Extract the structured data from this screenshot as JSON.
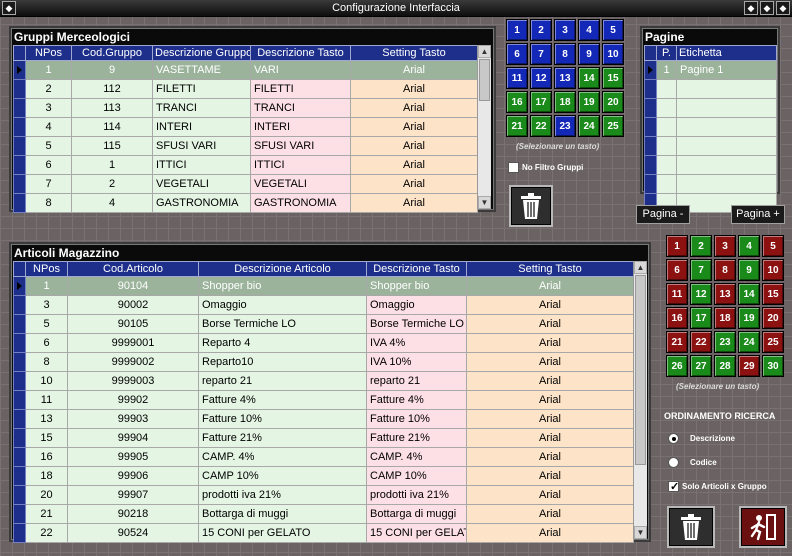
{
  "window": {
    "title": "Configurazione Interfaccia"
  },
  "gruppi": {
    "title": "Gruppi Merceologici",
    "columns": [
      "NPos",
      "Cod.Gruppo",
      "Descrizione Gruppo",
      "Descrizione Tasto",
      "Setting Tasto"
    ],
    "rows": [
      {
        "npos": "1",
        "cod": "9",
        "desc": "VASETTAME",
        "tasto": "VARI",
        "setting": "Arial"
      },
      {
        "npos": "2",
        "cod": "112",
        "desc": "FILETTI",
        "tasto": "FILETTI",
        "setting": "Arial"
      },
      {
        "npos": "3",
        "cod": "113",
        "desc": "TRANCI",
        "tasto": "TRANCI",
        "setting": "Arial"
      },
      {
        "npos": "4",
        "cod": "114",
        "desc": "INTERI",
        "tasto": "INTERI",
        "setting": "Arial"
      },
      {
        "npos": "5",
        "cod": "115",
        "desc": "SFUSI VARI",
        "tasto": "SFUSI VARI",
        "setting": "Arial"
      },
      {
        "npos": "6",
        "cod": "1",
        "desc": "ITTICI",
        "tasto": "ITTICI",
        "setting": "Arial"
      },
      {
        "npos": "7",
        "cod": "2",
        "desc": "VEGETALI",
        "tasto": "VEGETALI",
        "setting": "Arial"
      },
      {
        "npos": "8",
        "cod": "4",
        "desc": "GASTRONOMIA",
        "tasto": "GASTRONOMIA",
        "setting": "Arial"
      }
    ]
  },
  "keypad_top": {
    "keys": [
      {
        "n": "1",
        "c": "blue"
      },
      {
        "n": "2",
        "c": "blue"
      },
      {
        "n": "3",
        "c": "blue"
      },
      {
        "n": "4",
        "c": "blue"
      },
      {
        "n": "5",
        "c": "blue"
      },
      {
        "n": "6",
        "c": "blue"
      },
      {
        "n": "7",
        "c": "blue"
      },
      {
        "n": "8",
        "c": "blue"
      },
      {
        "n": "9",
        "c": "blue"
      },
      {
        "n": "10",
        "c": "blue"
      },
      {
        "n": "11",
        "c": "blue"
      },
      {
        "n": "12",
        "c": "blue"
      },
      {
        "n": "13",
        "c": "blue"
      },
      {
        "n": "14",
        "c": "green"
      },
      {
        "n": "15",
        "c": "green"
      },
      {
        "n": "16",
        "c": "green"
      },
      {
        "n": "17",
        "c": "green"
      },
      {
        "n": "18",
        "c": "green"
      },
      {
        "n": "19",
        "c": "green"
      },
      {
        "n": "20",
        "c": "green"
      },
      {
        "n": "21",
        "c": "green"
      },
      {
        "n": "22",
        "c": "green"
      },
      {
        "n": "23",
        "c": "blue"
      },
      {
        "n": "24",
        "c": "green"
      },
      {
        "n": "25",
        "c": "green"
      }
    ],
    "hint": "(Selezionare un tasto)",
    "no_filter_label": "No Filtro Gruppi"
  },
  "pagine": {
    "title": "Pagine",
    "columns": [
      "P.",
      "Etichetta"
    ],
    "rows": [
      {
        "p": "1",
        "label": "Pagine 1"
      }
    ],
    "prev_label": "Pagina -",
    "next_label": "Pagina +"
  },
  "articoli": {
    "title": "Articoli Magazzino",
    "columns": [
      "NPos",
      "Cod.Articolo",
      "Descrizione Articolo",
      "Descrizione Tasto",
      "Setting Tasto"
    ],
    "rows": [
      {
        "npos": "1",
        "cod": "90104",
        "desc": "Shopper bio",
        "tasto": "Shopper bio",
        "setting": "Arial"
      },
      {
        "npos": "3",
        "cod": "90002",
        "desc": "Omaggio",
        "tasto": "Omaggio",
        "setting": "Arial"
      },
      {
        "npos": "5",
        "cod": "90105",
        "desc": "Borse Termiche LO",
        "tasto": "Borse Termiche LO",
        "setting": "Arial"
      },
      {
        "npos": "6",
        "cod": "9999001",
        "desc": "Reparto 4",
        "tasto": "IVA 4%",
        "setting": "Arial"
      },
      {
        "npos": "8",
        "cod": "9999002",
        "desc": "Reparto10",
        "tasto": " IVA 10%",
        "setting": "Arial"
      },
      {
        "npos": "10",
        "cod": "9999003",
        "desc": "reparto 21",
        "tasto": "reparto 21",
        "setting": "Arial"
      },
      {
        "npos": "11",
        "cod": "99902",
        "desc": "Fatture 4%",
        "tasto": "Fatture 4%",
        "setting": "Arial"
      },
      {
        "npos": "13",
        "cod": "99903",
        "desc": "Fatture 10%",
        "tasto": "Fatture 10%",
        "setting": "Arial"
      },
      {
        "npos": "15",
        "cod": "99904",
        "desc": "Fatture 21%",
        "tasto": "Fatture 21%",
        "setting": "Arial"
      },
      {
        "npos": "16",
        "cod": "99905",
        "desc": "CAMP. 4%",
        "tasto": "CAMP. 4%",
        "setting": "Arial"
      },
      {
        "npos": "18",
        "cod": "99906",
        "desc": "CAMP 10%",
        "tasto": "CAMP 10%",
        "setting": "Arial"
      },
      {
        "npos": "20",
        "cod": "99907",
        "desc": "prodotti iva 21%",
        "tasto": "prodotti iva 21%",
        "setting": "Arial"
      },
      {
        "npos": "21",
        "cod": "90218",
        "desc": "Bottarga di muggi",
        "tasto": "Bottarga di muggi",
        "setting": "Arial"
      },
      {
        "npos": "22",
        "cod": "90524",
        "desc": "15 CONI per GELATO",
        "tasto": "15 CONI per GELAT",
        "setting": "Arial"
      }
    ]
  },
  "keypad_bottom": {
    "keys": [
      {
        "n": "1",
        "c": "red"
      },
      {
        "n": "2",
        "c": "green"
      },
      {
        "n": "3",
        "c": "red"
      },
      {
        "n": "4",
        "c": "green"
      },
      {
        "n": "5",
        "c": "red"
      },
      {
        "n": "6",
        "c": "red"
      },
      {
        "n": "7",
        "c": "green"
      },
      {
        "n": "8",
        "c": "red"
      },
      {
        "n": "9",
        "c": "green"
      },
      {
        "n": "10",
        "c": "red"
      },
      {
        "n": "11",
        "c": "red"
      },
      {
        "n": "12",
        "c": "green"
      },
      {
        "n": "13",
        "c": "red"
      },
      {
        "n": "14",
        "c": "green"
      },
      {
        "n": "15",
        "c": "red"
      },
      {
        "n": "16",
        "c": "red"
      },
      {
        "n": "17",
        "c": "green"
      },
      {
        "n": "18",
        "c": "red"
      },
      {
        "n": "19",
        "c": "green"
      },
      {
        "n": "20",
        "c": "red"
      },
      {
        "n": "21",
        "c": "red"
      },
      {
        "n": "22",
        "c": "red"
      },
      {
        "n": "23",
        "c": "green"
      },
      {
        "n": "24",
        "c": "green"
      },
      {
        "n": "25",
        "c": "red"
      },
      {
        "n": "26",
        "c": "green"
      },
      {
        "n": "27",
        "c": "green"
      },
      {
        "n": "28",
        "c": "green"
      },
      {
        "n": "29",
        "c": "red"
      },
      {
        "n": "30",
        "c": "green"
      }
    ],
    "hint": "(Selezionare un tasto)"
  },
  "ordinamento": {
    "title": "ORDINAMENTO RICERCA",
    "descrizione_label": "Descrizione",
    "codice_label": "Codice",
    "solo_label": "Solo Articoli x Gruppo"
  },
  "icons": {
    "trash": "trash-icon",
    "exit": "exit-icon"
  }
}
